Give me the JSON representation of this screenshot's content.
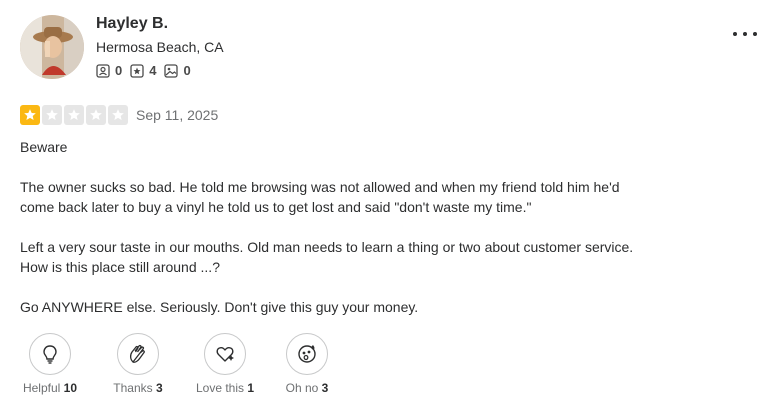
{
  "user": {
    "name": "Hayley B.",
    "location": "Hermosa Beach, CA",
    "stats": [
      {
        "icon": "friends-icon",
        "value": "0"
      },
      {
        "icon": "reviews-icon",
        "value": "4"
      },
      {
        "icon": "photos-icon",
        "value": "0"
      }
    ]
  },
  "review": {
    "rating": 1,
    "rating_max": 5,
    "date": "Sep 11, 2025",
    "paragraphs": [
      "Beware",
      "The owner sucks so bad. He told me browsing was not allowed and when my friend told him he'd\ncome back later to buy a vinyl he told us to get lost and said \"don't waste my time.\"",
      "Left a very sour taste in our mouths. Old man needs to learn a thing or two about customer service.\nHow is this place still around ...?",
      "Go ANYWHERE else. Seriously. Don't give this guy your money."
    ]
  },
  "reactions": [
    {
      "icon": "lightbulb-icon",
      "label": "Helpful",
      "count": "10"
    },
    {
      "icon": "clapping-hands-icon",
      "label": "Thanks",
      "count": "3"
    },
    {
      "icon": "heart-icon",
      "label": "Love this",
      "count": "1"
    },
    {
      "icon": "surprised-face-icon",
      "label": "Oh no",
      "count": "3"
    }
  ],
  "colors": {
    "star_filled": "#fbb813",
    "star_empty": "#e6e6e6",
    "text": "#2d2e2f",
    "muted": "#6e7072"
  }
}
